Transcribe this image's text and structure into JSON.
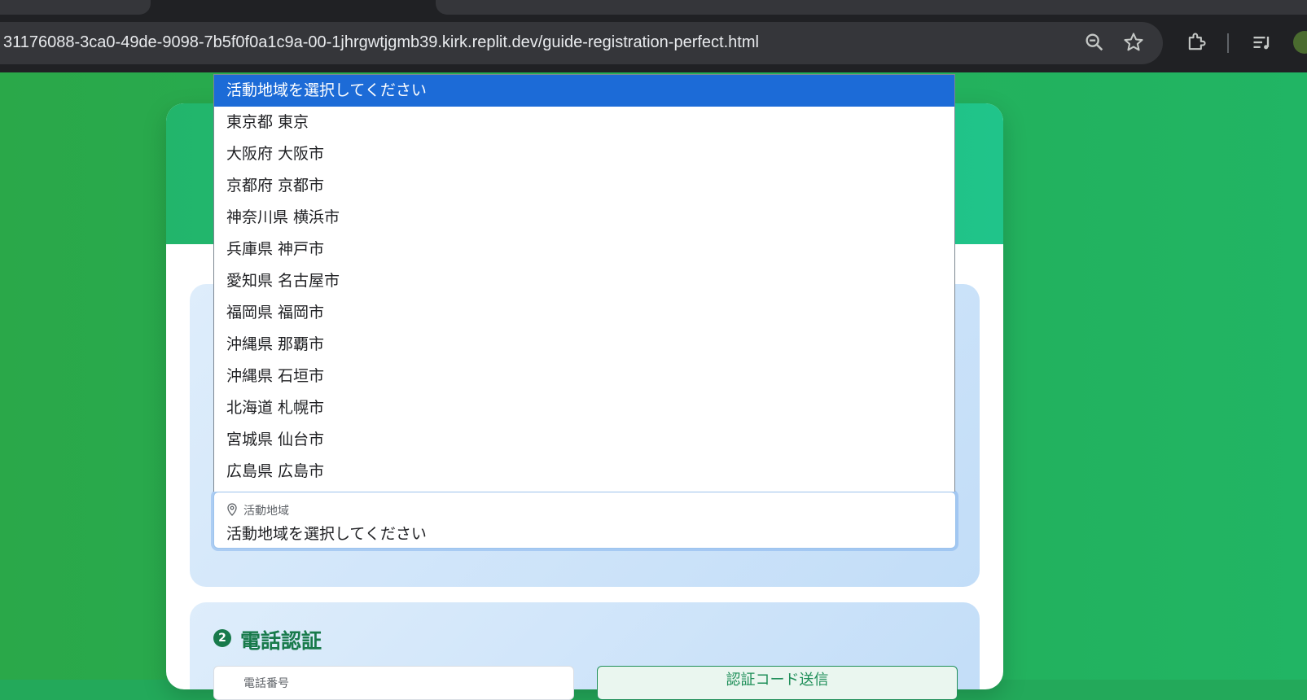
{
  "browser": {
    "url": "31176088-3ca0-49de-9098-7b5f0f0a1c9a-00-1jhrgwtjgmb39.kirk.replit.dev/guide-registration-perfect.html",
    "icons": [
      "zoom-icon",
      "star-icon",
      "extensions-icon",
      "reading-list-icon",
      "profile-avatar"
    ]
  },
  "region_select": {
    "label": "活動地域",
    "value": "活動地域を選択してください",
    "options": [
      "活動地域を選択してください",
      "東京都 東京",
      "大阪府 大阪市",
      "京都府 京都市",
      "神奈川県 横浜市",
      "兵庫県 神戸市",
      "愛知県 名古屋市",
      "福岡県 福岡市",
      "沖縄県 那覇市",
      "沖縄県 石垣市",
      "北海道 札幌市",
      "宮城県 仙台市",
      "広島県 広島市"
    ],
    "selected_index": 0
  },
  "phone_section": {
    "step": "2",
    "title": "電話認証",
    "phone_label": "電話番号",
    "send_button": "認証コード送信"
  },
  "colors": {
    "accent_green": "#187a4b",
    "selected_option": "#1c6bd7",
    "page_background": "#23a95a"
  }
}
